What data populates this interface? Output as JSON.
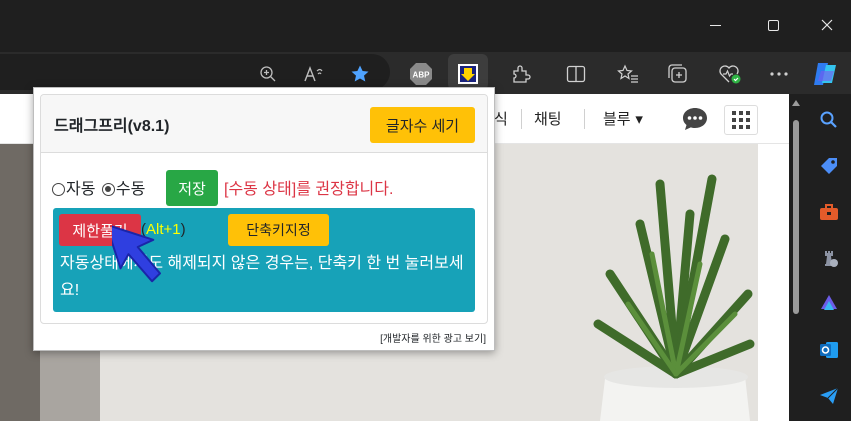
{
  "browser": {
    "window_controls": [
      "minimize",
      "maximize",
      "close"
    ],
    "toolbar_icons": [
      "zoom-icon",
      "read-aloud-icon",
      "favorite-star-icon",
      "adblock-plus-icon",
      "dragfree-extension-icon",
      "extensions-icon",
      "split-screen-icon",
      "favorites-icon",
      "collections-icon",
      "browser-essentials-icon",
      "more-menu-icon",
      "copilot-icon"
    ],
    "adblock_label": "ABP",
    "sidebar_icons": [
      "search-icon",
      "tag-icon",
      "toolbox-icon",
      "chess-icon",
      "copilot-icon",
      "outlook-icon",
      "send-icon"
    ],
    "accent": "#4fa3ff"
  },
  "page": {
    "nav_items": [
      "식",
      "채팅",
      "블루 ▾"
    ]
  },
  "popup": {
    "title": "드래그프리(v8.1)",
    "count_button": "글자수 세기",
    "radio_auto": "자동",
    "radio_manual": "수동",
    "selected_mode": "수동",
    "save_button": "저장",
    "recommend_text": "[수동 상태]를 권장합니다.",
    "unlock_button": "제한풀기",
    "hotkey_open": "(",
    "hotkey": "Alt+1",
    "hotkey_close": ")",
    "set_hotkey_button": "단축키지정",
    "alert_text": "자동상태에서도 해제되지 않은 경우는, 단축키 한 번 눌러보세요!",
    "ad_link": "[개발자를 위한 광고 보기]",
    "colors": {
      "warning": "#ffc107",
      "success": "#28a745",
      "danger": "#dc3545",
      "info": "#17a2b8",
      "hotkey": "#ffff00"
    }
  }
}
